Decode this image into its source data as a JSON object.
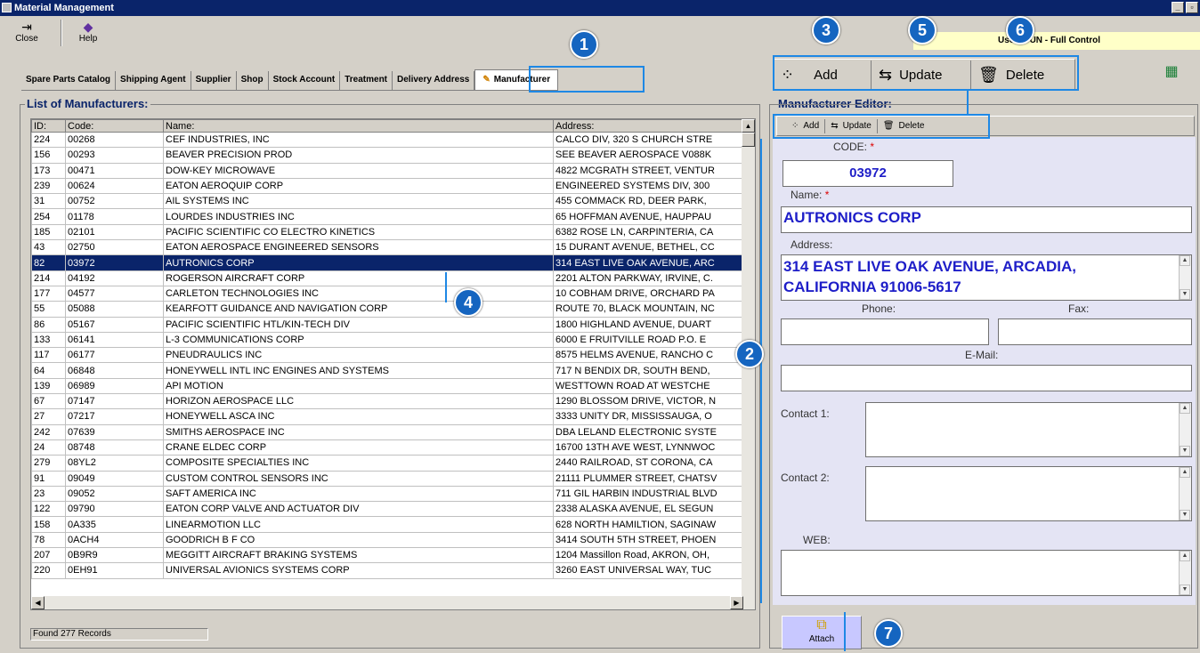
{
  "window": {
    "title": "Material Management",
    "min": "_",
    "max": "▫"
  },
  "toolbar": {
    "close_label": "Close",
    "help_label": "Help"
  },
  "user_banner": "User: DUN - Full Control",
  "tabs": [
    {
      "label": "Spare Parts Catalog"
    },
    {
      "label": "Shipping Agent"
    },
    {
      "label": "Supplier"
    },
    {
      "label": "Shop"
    },
    {
      "label": "Stock Account"
    },
    {
      "label": "Treatment"
    },
    {
      "label": "Delivery Address"
    },
    {
      "label": "Manufacturer"
    }
  ],
  "list": {
    "title": "List of Manufacturers:",
    "columns": [
      "ID:",
      "Code:",
      "Name:",
      "Address:"
    ],
    "rows": [
      [
        "224",
        "00268",
        "CEF INDUSTRIES, INC",
        "CALCO DIV, 320 S CHURCH STRE"
      ],
      [
        "156",
        "00293",
        "BEAVER PRECISION PROD",
        "SEE BEAVER AEROSPACE V088K"
      ],
      [
        "173",
        "00471",
        "DOW-KEY MICROWAVE",
        "4822 MCGRATH STREET, VENTUR"
      ],
      [
        "239",
        "00624",
        "EATON AEROQUIP CORP",
        "ENGINEERED SYSTEMS DIV, 300"
      ],
      [
        "31",
        "00752",
        "AIL SYSTEMS INC",
        "455 COMMACK RD, DEER PARK,"
      ],
      [
        "254",
        "01178",
        "LOURDES INDUSTRIES INC",
        "65 HOFFMAN AVENUE, HAUPPAU"
      ],
      [
        "185",
        "02101",
        "PACIFIC SCIENTIFIC CO ELECTRO KINETICS",
        "6382 ROSE LN, CARPINTERIA, CA"
      ],
      [
        "43",
        "02750",
        "EATON AEROSPACE ENGINEERED SENSORS",
        "15 DURANT AVENUE, BETHEL, CC"
      ],
      [
        "82",
        "03972",
        "AUTRONICS CORP",
        "314 EAST LIVE OAK AVENUE, ARC"
      ],
      [
        "214",
        "04192",
        "ROGERSON AIRCRAFT CORP",
        "2201 ALTON PARKWAY, IRVINE, C."
      ],
      [
        "177",
        "04577",
        "CARLETON TECHNOLOGIES INC",
        "10 COBHAM DRIVE, ORCHARD PA"
      ],
      [
        "55",
        "05088",
        "KEARFOTT GUIDANCE AND NAVIGATION CORP",
        "ROUTE 70, BLACK MOUNTAIN, NC"
      ],
      [
        "86",
        "05167",
        "PACIFIC SCIENTIFIC HTL/KIN-TECH DIV",
        "1800 HIGHLAND AVENUE, DUART"
      ],
      [
        "133",
        "06141",
        "L-3 COMMUNICATIONS CORP",
        "6000 E FRUITVILLE ROAD P.O. E"
      ],
      [
        "117",
        "06177",
        "PNEUDRAULICS INC",
        "8575 HELMS AVENUE, RANCHO C"
      ],
      [
        "64",
        "06848",
        "HONEYWELL INTL INC ENGINES AND SYSTEMS",
        "717 N BENDIX DR, SOUTH BEND,"
      ],
      [
        "139",
        "06989",
        "API MOTION",
        "WESTTOWN ROAD AT WESTCHE"
      ],
      [
        "67",
        "07147",
        "HORIZON AEROSPACE LLC",
        "1290 BLOSSOM DRIVE, VICTOR, N"
      ],
      [
        "27",
        "07217",
        "HONEYWELL ASCA INC",
        "3333 UNITY DR, MISSISSAUGA, O"
      ],
      [
        "242",
        "07639",
        "SMITHS AEROSPACE INC",
        "DBA LELAND ELECTRONIC SYSTE"
      ],
      [
        "24",
        "08748",
        "CRANE ELDEC CORP",
        "16700 13TH AVE WEST, LYNNWOC"
      ],
      [
        "279",
        "08YL2",
        "COMPOSITE SPECIALTIES INC",
        "2440 RAILROAD, ST CORONA, CA"
      ],
      [
        "91",
        "09049",
        "CUSTOM CONTROL SENSORS INC",
        "21111 PLUMMER STREET, CHATSV"
      ],
      [
        "23",
        "09052",
        "SAFT AMERICA INC",
        "711 GIL HARBIN INDUSTRIAL BLVD"
      ],
      [
        "122",
        "09790",
        "EATON CORP VALVE AND ACTUATOR DIV",
        "2338 ALASKA AVENUE, EL SEGUN"
      ],
      [
        "158",
        "0A335",
        "LINEARMOTION LLC",
        "628 NORTH HAMILTION, SAGINAW"
      ],
      [
        "78",
        "0ACH4",
        "GOODRICH B F CO",
        "3414 SOUTH 5TH STREET, PHOEN"
      ],
      [
        "207",
        "0B9R9",
        "MEGGITT AIRCRAFT BRAKING SYSTEMS",
        "1204 Massillon Road, AKRON, OH,"
      ],
      [
        "220",
        "0EH91",
        "UNIVERSAL AVIONICS SYSTEMS CORP",
        "3260 EAST UNIVERSAL WAY, TUC"
      ]
    ],
    "selected_row": 8,
    "status": "Found 277 Records"
  },
  "big_toolbar": {
    "add": "Add",
    "update": "Update",
    "delete": "Delete"
  },
  "editor": {
    "title": "Manufacturer Editor:",
    "toolbar": {
      "add": "Add",
      "update": "Update",
      "delete": "Delete"
    },
    "code_label": "CODE:",
    "code_value": "03972",
    "name_label": "Name:",
    "name_value": "AUTRONICS CORP",
    "address_label": "Address:",
    "address_line1": "314 EAST LIVE OAK AVENUE, ARCADIA,",
    "address_line2": "CALIFORNIA 91006-5617",
    "phone_label": "Phone:",
    "phone_value": "",
    "fax_label": "Fax:",
    "fax_value": "",
    "email_label": "E-Mail:",
    "email_value": "",
    "contact1_label": "Contact 1:",
    "contact2_label": "Contact 2:",
    "web_label": "WEB:",
    "required_mark": "*"
  },
  "attach_label": "Attach",
  "callouts": [
    "1",
    "2",
    "3",
    "4",
    "5",
    "6",
    "7"
  ],
  "colors": {
    "accent": "#1565c0",
    "selection": "#0a246a",
    "value_text": "#1e1ec8"
  }
}
